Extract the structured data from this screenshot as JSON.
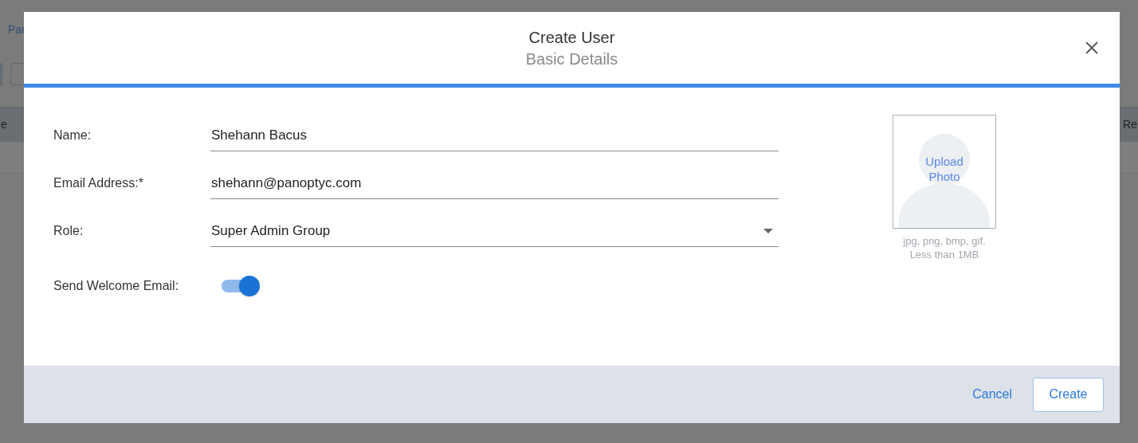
{
  "background": {
    "link": "Par",
    "table_header_left": "e",
    "table_header_right": "Re"
  },
  "dialog": {
    "title": "Create User",
    "subtitle": "Basic Details",
    "fields": [
      {
        "kind": "text",
        "label": "Name:",
        "value": "Shehann Bacus"
      },
      {
        "kind": "text",
        "label": "Email Address:*",
        "value": "shehann@panoptyc.com"
      },
      {
        "kind": "select",
        "label": "Role:",
        "value": "Super Admin Group"
      },
      {
        "kind": "toggle",
        "label": "Send Welcome Email:",
        "on": true
      }
    ],
    "photo": {
      "label_lines": [
        "Upload",
        "Photo"
      ],
      "hint_lines": [
        "jpg, png, bmp, gif.",
        "Less than 1MB"
      ]
    },
    "buttons": [
      {
        "kind": "link",
        "label": "Cancel"
      },
      {
        "kind": "outlined",
        "label": "Create"
      }
    ]
  }
}
